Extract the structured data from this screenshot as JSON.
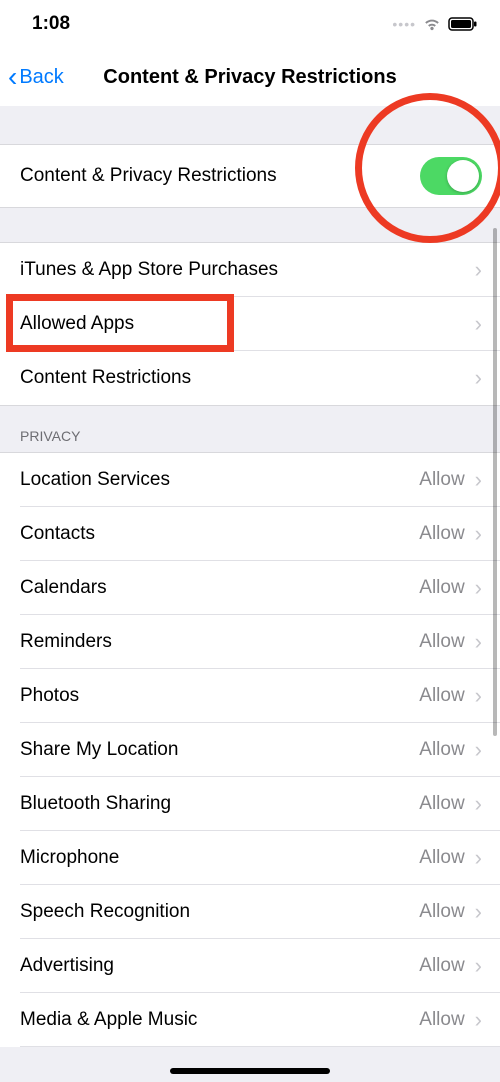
{
  "status": {
    "time": "1:08"
  },
  "nav": {
    "back": "Back",
    "title": "Content & Privacy Restrictions"
  },
  "main_toggle": {
    "label": "Content & Privacy Restrictions",
    "on": true
  },
  "group2": [
    {
      "label": "iTunes & App Store Purchases"
    },
    {
      "label": "Allowed Apps"
    },
    {
      "label": "Content Restrictions"
    }
  ],
  "privacy_header": "Privacy",
  "privacy": [
    {
      "label": "Location Services",
      "value": "Allow"
    },
    {
      "label": "Contacts",
      "value": "Allow"
    },
    {
      "label": "Calendars",
      "value": "Allow"
    },
    {
      "label": "Reminders",
      "value": "Allow"
    },
    {
      "label": "Photos",
      "value": "Allow"
    },
    {
      "label": "Share My Location",
      "value": "Allow"
    },
    {
      "label": "Bluetooth Sharing",
      "value": "Allow"
    },
    {
      "label": "Microphone",
      "value": "Allow"
    },
    {
      "label": "Speech Recognition",
      "value": "Allow"
    },
    {
      "label": "Advertising",
      "value": "Allow"
    },
    {
      "label": "Media & Apple Music",
      "value": "Allow"
    }
  ]
}
